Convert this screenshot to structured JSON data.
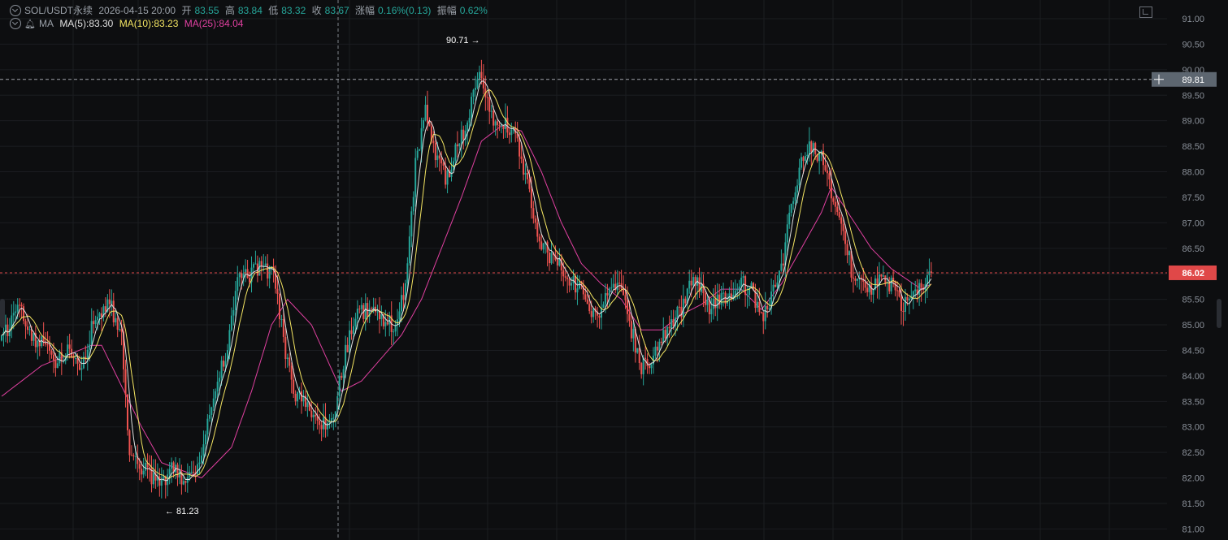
{
  "header": {
    "symbol": "SOL/USDT永续",
    "datetime": "2026-04-15 20:00",
    "open_label": "开",
    "open_value": "83.55",
    "high_label": "高",
    "high_value": "83.84",
    "low_label": "低",
    "low_value": "83.32",
    "close_label": "收",
    "close_value": "83.67",
    "change_label": "涨幅",
    "change_value": "0.16%(0.13)",
    "amplitude_label": "振幅",
    "amplitude_value": "0.62%",
    "ma_label": "MA",
    "ma5": "MA(5):83.30",
    "ma10": "MA(10):83.23",
    "ma25": "MA(25):84.04"
  },
  "annotations": {
    "high_marker": "90.71 →",
    "low_marker": "← 81.23",
    "crosshair_price": "89.81",
    "current_price": "86.02"
  },
  "colors": {
    "background": "#0d0e10",
    "up": "#26a69a",
    "down": "#ef5350",
    "ma5": "#e0e0e0",
    "ma10": "#f5e663",
    "ma25": "#e040a0",
    "grid": "#1b1d21",
    "axis_text": "#8a9099",
    "price_tag": "#e04848",
    "crosshair_tag": "#5d6670"
  },
  "chart_data": {
    "type": "candlestick",
    "ylim": [
      80.8,
      91.35
    ],
    "y_ticks": [
      81.0,
      81.5,
      82.0,
      82.5,
      83.0,
      83.5,
      84.0,
      84.5,
      85.0,
      85.5,
      86.0,
      86.5,
      87.0,
      87.5,
      88.0,
      88.5,
      89.0,
      89.5,
      90.0,
      90.5,
      91.0
    ],
    "close_path": [
      [
        0,
        84.7
      ],
      [
        6,
        85.2
      ],
      [
        10,
        85.3
      ],
      [
        14,
        84.8
      ],
      [
        20,
        84.6
      ],
      [
        26,
        84.3
      ],
      [
        34,
        84.5
      ],
      [
        40,
        84.2
      ],
      [
        47,
        85.2
      ],
      [
        54,
        85.4
      ],
      [
        60,
        84.8
      ],
      [
        64,
        82.5
      ],
      [
        68,
        82.2
      ],
      [
        74,
        82.1
      ],
      [
        80,
        81.8
      ],
      [
        84,
        82.2
      ],
      [
        90,
        82.0
      ],
      [
        97,
        82.0
      ],
      [
        103,
        83.0
      ],
      [
        108,
        84.0
      ],
      [
        112,
        84.3
      ],
      [
        118,
        85.9
      ],
      [
        124,
        86.0
      ],
      [
        130,
        86.1
      ],
      [
        136,
        86.0
      ],
      [
        141,
        84.7
      ],
      [
        146,
        83.7
      ],
      [
        150,
        83.5
      ],
      [
        155,
        83.2
      ],
      [
        160,
        83.0
      ],
      [
        166,
        83.2
      ],
      [
        172,
        84.5
      ],
      [
        178,
        85.2
      ],
      [
        184,
        85.3
      ],
      [
        190,
        85.1
      ],
      [
        196,
        85.0
      ],
      [
        202,
        85.7
      ],
      [
        207,
        88.1
      ],
      [
        212,
        89.2
      ],
      [
        216,
        88.5
      ],
      [
        220,
        88.0
      ],
      [
        224,
        87.8
      ],
      [
        228,
        88.6
      ],
      [
        232,
        88.8
      ],
      [
        236,
        89.6
      ],
      [
        240,
        89.9
      ],
      [
        245,
        89.1
      ],
      [
        250,
        89.0
      ],
      [
        255,
        88.8
      ],
      [
        260,
        88.3
      ],
      [
        265,
        87.3
      ],
      [
        270,
        86.6
      ],
      [
        275,
        86.3
      ],
      [
        280,
        86.1
      ],
      [
        285,
        85.8
      ],
      [
        290,
        85.8
      ],
      [
        295,
        85.2
      ],
      [
        300,
        85.3
      ],
      [
        305,
        85.8
      ],
      [
        310,
        85.6
      ],
      [
        315,
        84.9
      ],
      [
        320,
        84.2
      ],
      [
        325,
        84.3
      ],
      [
        330,
        84.8
      ],
      [
        335,
        85.0
      ],
      [
        340,
        85.3
      ],
      [
        345,
        85.9
      ],
      [
        350,
        85.7
      ],
      [
        355,
        85.3
      ],
      [
        360,
        85.5
      ],
      [
        365,
        85.6
      ],
      [
        370,
        85.8
      ],
      [
        375,
        85.7
      ],
      [
        380,
        85.1
      ],
      [
        385,
        85.5
      ],
      [
        390,
        86.1
      ],
      [
        395,
        87.3
      ],
      [
        400,
        88.2
      ],
      [
        405,
        88.5
      ],
      [
        410,
        88.3
      ],
      [
        415,
        87.6
      ],
      [
        420,
        87.0
      ],
      [
        425,
        86.1
      ],
      [
        430,
        85.8
      ],
      [
        435,
        85.7
      ],
      [
        440,
        85.9
      ],
      [
        445,
        85.8
      ],
      [
        450,
        85.4
      ],
      [
        455,
        85.5
      ],
      [
        460,
        85.8
      ],
      [
        465,
        85.9
      ]
    ],
    "ma25_path": [
      [
        0,
        83.6
      ],
      [
        20,
        84.2
      ],
      [
        45,
        84.6
      ],
      [
        50,
        84.6
      ],
      [
        60,
        83.8
      ],
      [
        70,
        83.0
      ],
      [
        80,
        82.3
      ],
      [
        100,
        82.0
      ],
      [
        115,
        82.6
      ],
      [
        125,
        83.7
      ],
      [
        135,
        85.0
      ],
      [
        143,
        85.5
      ],
      [
        155,
        85.0
      ],
      [
        170,
        83.7
      ],
      [
        180,
        83.9
      ],
      [
        200,
        84.8
      ],
      [
        210,
        85.5
      ],
      [
        220,
        86.5
      ],
      [
        230,
        87.5
      ],
      [
        240,
        88.6
      ],
      [
        250,
        88.9
      ],
      [
        260,
        88.8
      ],
      [
        270,
        88.0
      ],
      [
        280,
        87.0
      ],
      [
        290,
        86.2
      ],
      [
        300,
        85.8
      ],
      [
        310,
        85.5
      ],
      [
        320,
        84.9
      ],
      [
        330,
        84.9
      ],
      [
        340,
        85.2
      ],
      [
        350,
        85.4
      ],
      [
        360,
        85.7
      ],
      [
        370,
        85.7
      ],
      [
        380,
        85.3
      ],
      [
        390,
        85.8
      ],
      [
        400,
        86.5
      ],
      [
        410,
        87.2
      ],
      [
        415,
        87.7
      ],
      [
        425,
        87.1
      ],
      [
        435,
        86.5
      ],
      [
        445,
        86.1
      ],
      [
        460,
        85.7
      ],
      [
        465,
        85.8
      ]
    ],
    "annotated_high": 90.71,
    "annotated_low": 81.23,
    "crosshair_level": 89.81,
    "current_price_level": 86.02
  }
}
